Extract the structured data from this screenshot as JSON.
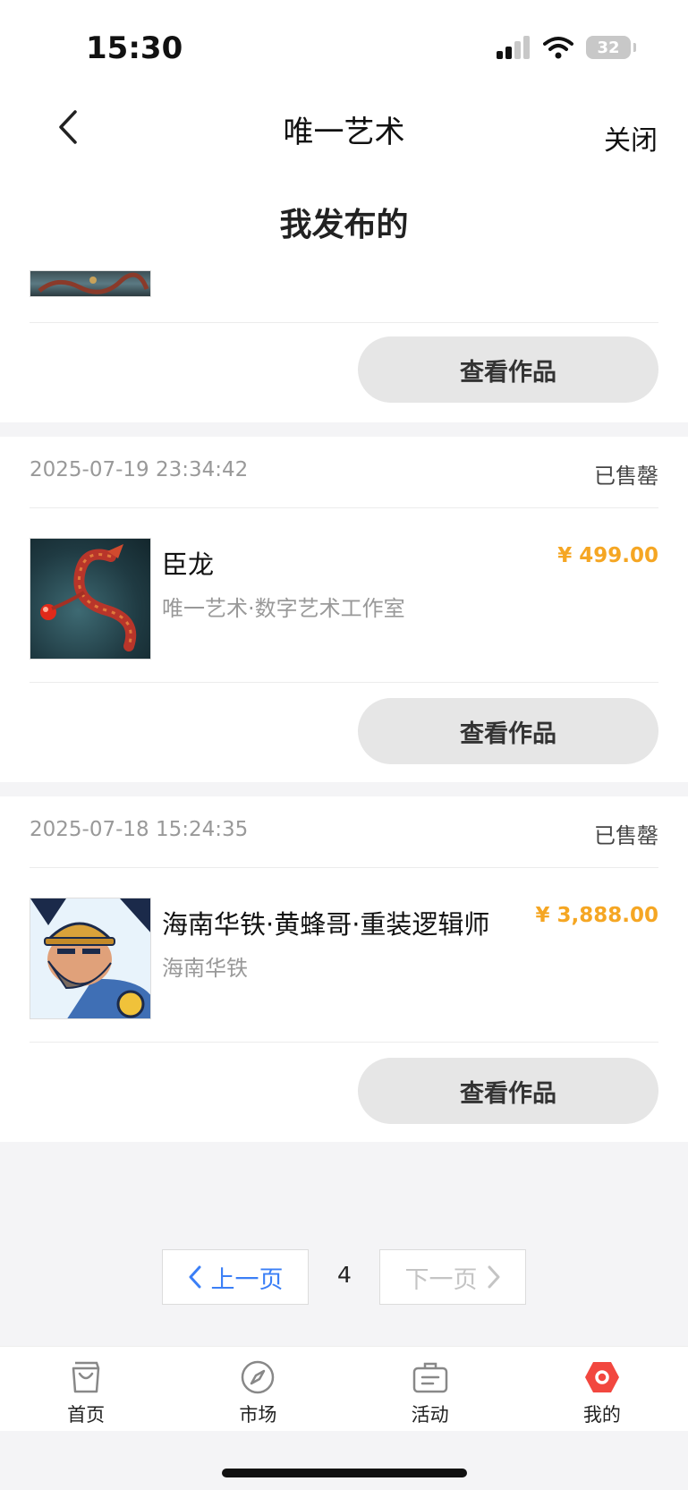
{
  "status_bar": {
    "time": "15:30",
    "battery": "32"
  },
  "nav": {
    "title": "唯一艺术",
    "close_label": "关闭"
  },
  "page_heading": "我发布的",
  "view_button_label": "查看作品",
  "orders": [
    {
      "date": "2025-07-19 23:34:42",
      "status": "已售罄",
      "name": "臣龙",
      "shop": "唯一艺术·数字艺术工作室",
      "price": "¥ 499.00",
      "thumb_icon": "dragon-artwork-thumbnail"
    },
    {
      "date": "2025-07-18 15:24:35",
      "status": "已售罄",
      "name": "海南华铁·黄蜂哥·重装逻辑师",
      "shop": "海南华铁",
      "price": "¥ 3,888.00",
      "thumb_icon": "bearded-worker-artwork-thumbnail"
    }
  ],
  "pager": {
    "prev_label": "上一页",
    "next_label": "下一页",
    "current_page": "4"
  },
  "tabs": [
    {
      "label": "首页",
      "icon": "shopping-bag-icon"
    },
    {
      "label": "市场",
      "icon": "compass-icon"
    },
    {
      "label": "活动",
      "icon": "briefcase-icon"
    },
    {
      "label": "我的",
      "icon": "profile-badge-icon"
    }
  ],
  "colors": {
    "price": "#f5a623",
    "accent": "#3b7ff6",
    "active_tab": "#f2473f"
  }
}
